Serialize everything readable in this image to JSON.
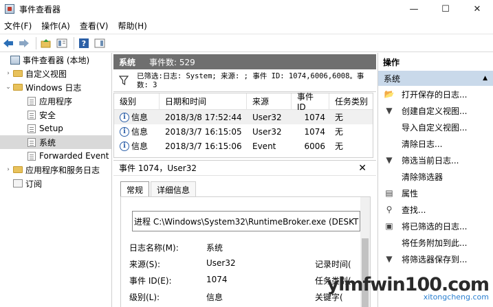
{
  "window": {
    "title": "事件查看器",
    "controls": {
      "minimize": "—",
      "maximize": "☐",
      "close": "✕"
    }
  },
  "menu": [
    "文件(F)",
    "操作(A)",
    "查看(V)",
    "帮助(H)"
  ],
  "toolbar": [
    "back-icon",
    "forward-icon",
    "up-folder-icon",
    "properties-icon",
    "help-icon",
    "panel-icon"
  ],
  "tree": [
    {
      "label": "事件查看器 (本地)",
      "indent": 0,
      "arrow": "",
      "icon": "viewer"
    },
    {
      "label": "自定义视图",
      "indent": 1,
      "arrow": "›",
      "icon": "folder"
    },
    {
      "label": "Windows 日志",
      "indent": 1,
      "arrow": "⌄",
      "icon": "folder"
    },
    {
      "label": "应用程序",
      "indent": 2,
      "arrow": "",
      "icon": "log"
    },
    {
      "label": "安全",
      "indent": 2,
      "arrow": "",
      "icon": "log"
    },
    {
      "label": "Setup",
      "indent": 2,
      "arrow": "",
      "icon": "log"
    },
    {
      "label": "系统",
      "indent": 2,
      "arrow": "",
      "icon": "log",
      "selected": true
    },
    {
      "label": "Forwarded Event",
      "indent": 2,
      "arrow": "",
      "icon": "log"
    },
    {
      "label": "应用程序和服务日志",
      "indent": 1,
      "arrow": "›",
      "icon": "folder"
    },
    {
      "label": "订阅",
      "indent": 1,
      "arrow": "",
      "icon": "sub"
    }
  ],
  "center": {
    "log_name": "系统",
    "event_count": "事件数: 529",
    "filter": "已筛选:日志: System; 来源: ; 事件 ID: 1074,6006,6008。事数: 3"
  },
  "events": {
    "columns": [
      "级别",
      "日期和时间",
      "来源",
      "事件 ID",
      "任务类别"
    ],
    "rows": [
      {
        "level": "信息",
        "date": "2018/3/8 17:52:44",
        "source": "User32",
        "id": "1074",
        "task": "无"
      },
      {
        "level": "信息",
        "date": "2018/3/7 16:15:05",
        "source": "User32",
        "id": "1074",
        "task": "无"
      },
      {
        "level": "信息",
        "date": "2018/3/7 16:15:06",
        "source": "Event",
        "id": "6006",
        "task": "无"
      }
    ]
  },
  "detail": {
    "title": "事件 1074，User32",
    "tabs": [
      "常规",
      "详细信息"
    ],
    "description": "进程 C:\\Windows\\System32\\RuntimeBroker.exe (DESKT",
    "fields": [
      {
        "label": "日志名称(M):",
        "value": "系统",
        "right_label": ""
      },
      {
        "label": "来源(S):",
        "value": "User32",
        "right_label": "记录时间("
      },
      {
        "label": "事件 ID(E):",
        "value": "1074",
        "right_label": "任务类别("
      },
      {
        "label": "级别(L):",
        "value": "信息",
        "right_label": "关键字("
      }
    ]
  },
  "actions": {
    "title": "操作",
    "section": "系统",
    "items": [
      {
        "label": "打开保存的日志...",
        "icon": "folder-open-icon",
        "glyph": "📂"
      },
      {
        "label": "创建自定义视图...",
        "icon": "filter-icon",
        "glyph": "▼"
      },
      {
        "label": "导入自定义视图...",
        "icon": "",
        "glyph": ""
      },
      {
        "label": "清除日志...",
        "icon": "",
        "glyph": ""
      },
      {
        "label": "筛选当前日志...",
        "icon": "filter-icon",
        "glyph": "▼"
      },
      {
        "label": "清除筛选器",
        "icon": "",
        "glyph": ""
      },
      {
        "label": "属性",
        "icon": "properties-icon",
        "glyph": "▤"
      },
      {
        "label": "查找...",
        "icon": "find-icon",
        "glyph": "⚲"
      },
      {
        "label": "将已筛选的日志...",
        "icon": "save-icon",
        "glyph": "▣"
      },
      {
        "label": "将任务附加到此...",
        "icon": "",
        "glyph": ""
      },
      {
        "label": "将筛选器保存到...",
        "icon": "filter-icon",
        "glyph": "▼"
      }
    ]
  },
  "watermark": {
    "main": "ylmfwin100.com",
    "sub": "xitongcheng.com"
  }
}
